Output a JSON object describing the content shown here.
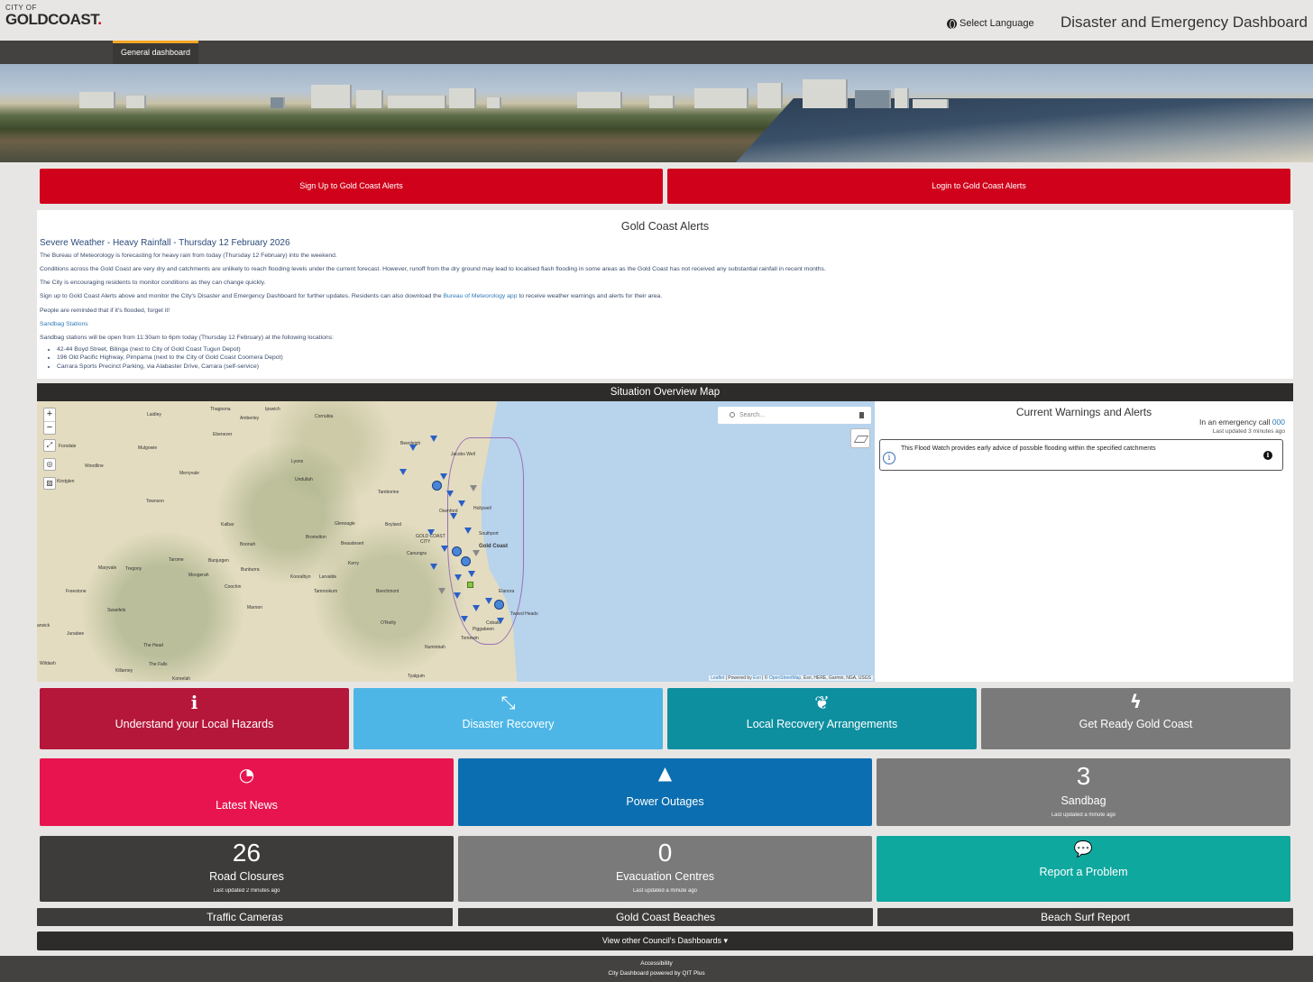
{
  "header": {
    "logo_small": "CITY OF",
    "logo_big": "GOLDCOAST",
    "logo_dot": ".",
    "language_label": "Select Language",
    "title": "Disaster and Emergency Dashboard"
  },
  "nav": {
    "tab": "General dashboard"
  },
  "alert_buttons": {
    "signup": "Sign Up to Gold Coast Alerts",
    "login": "Login to Gold Coast Alerts"
  },
  "alerts": {
    "heading": "Gold Coast Alerts",
    "subheading": "Severe Weather - Heavy Rainfall - Thursday 12 February 2026",
    "p1": "The Bureau of Meteorology is forecasting for heavy rain from today (Thursday 12 February) into the weekend.",
    "p2": "Conditions across the Gold Coast are very dry and catchments are unlikely to reach flooding levels under the current forecast. However, runoff from the dry ground may lead to localised flash flooding in some areas as the Gold Coast has not received any substantial rainfall in recent months.",
    "p3": "The City is encouraging residents to monitor conditions as they can change quickly.",
    "p4_pre": "Sign up to Gold Coast Alerts above and monitor the City's Disaster and Emergency Dashboard for further updates. Residents can also download the ",
    "p4_link": "Bureau of Meteorology app",
    "p4_post": " to receive weather warnings and alerts for their area.",
    "p5": "People are reminded that if it's flooded, forget it!",
    "sandbag_heading": "Sandbag Stations",
    "sandbag_intro": "Sandbag stations will be open from 11:30am to 6pm today (Thursday 12 February) at the following locations:",
    "locations": [
      "42-44 Boyd Street, Bilinga (next to City of Gold Coast Tugun Depot)",
      "196 Old Pacific Highway, Pimpama (next to the City of Gold Coast Coomera Depot)",
      "Carrara Sports Precinct Parking, via Alabaster Drive, Carrara (self-service)"
    ]
  },
  "map": {
    "title": "Situation Overview Map",
    "search_placeholder": "Search...",
    "zoom_in": "+",
    "zoom_out": "−",
    "attribution_leaflet": "Leaflet",
    "attribution_mid": " | Powered by ",
    "attribution_esri": "Esri",
    "attribution_sep": " | © ",
    "attribution_osm": "OpenStreetMap",
    "attribution_rest": ", Esri, HERE, Garmin, NGA, USGS",
    "labels": {
      "laidley": "Laidley",
      "thagoona": "Thagoona",
      "amberley": "Amberley",
      "ipswich": "Ipswich",
      "cornubia": "Cornubia",
      "ebenezer": "Ebenezer",
      "lyons": "Lyons",
      "forsdale": "Forsdale",
      "mulgowie": "Mulgowie",
      "woodline": "Woodline",
      "merryvale": "Merryvale",
      "undullah": "Undullah",
      "kirstglen": "Kirstglen",
      "townson": "Townson",
      "kalbar": "Kalbar",
      "glenoagle": "Glenoagle",
      "boonah": "Boonah",
      "bromelton": "Bromelton",
      "beaudesert": "Beaudesert",
      "boyland": "Boyland",
      "tamborine": "Tamborine",
      "oxenford": "Oxenford",
      "hollywell": "Hollywell",
      "southport": "Southport",
      "gold_coast": "Gold Coast",
      "city_label": "CITY",
      "gold_coast_city": "GOLD COAST",
      "kerry": "Kerry",
      "canungra": "Canungra",
      "maryvale": "Maryvale",
      "tregony": "Tregony",
      "tarome": "Tarome",
      "bunjurgen": "Bunjurgen",
      "bunburra": "Bunburra",
      "moogerah": "Moogerah",
      "kooralbyn": "Kooralbyn",
      "larvalde": "Larvalde",
      "freestone": "Freestone",
      "coochin": "Coochin",
      "tamrookum": "Tamrookum",
      "beechmont": "Beechmont",
      "elanora": "Elanora",
      "swanfels": "Swanfels",
      "maroon": "Maroon",
      "oreilly": "O'Reilly",
      "tweed_heads": "Tweed Heads",
      "cobaki": "Cobaki",
      "warwick": "arwick",
      "junabee": "Junabee",
      "piggabeen": "Piggabeen",
      "tomewin": "Tomewin",
      "numinbah": "Numinbah",
      "the_head": "The Head",
      "killarney": "Killarney",
      "the_falls": "The Falls",
      "wildash": "Wildash",
      "koreelah": "Koreelah",
      "tyalgum": "Tyalgum",
      "beenleigh": "Beenleigh",
      "jacobs_well": "Jacobs Well"
    }
  },
  "warnings": {
    "title": "Current Warnings and Alerts",
    "emergency_prefix": "In an emergency call ",
    "emergency_number": "000",
    "updated": "Last updated 3 minutes ago",
    "card_text": "This Flood Watch provides early advice of possible flooding within the specified catchments",
    "card_icon": "i"
  },
  "tiles_row1": [
    {
      "label": "Understand your Local Hazards",
      "icon": "info-icon",
      "glyph": "i",
      "color": "#b5173a"
    },
    {
      "label": "Disaster Recovery",
      "icon": "handshake-icon",
      "glyph": "⤡",
      "color": "#4db6e6"
    },
    {
      "label": "Local Recovery Arrangements",
      "icon": "leaf-icon",
      "glyph": "❦",
      "color": "#0e8fa0"
    },
    {
      "label": "Get Ready Gold Coast",
      "icon": "lightning-icon",
      "glyph": "ϟ",
      "color": "#7a7a7a"
    }
  ],
  "tiles_row2": [
    {
      "label": "Latest News",
      "icon": "rss-icon",
      "glyph": "◔",
      "color": "#e8144f"
    },
    {
      "label": "Power Outages",
      "icon": "power-warning-icon",
      "glyph": "▲",
      "color": "#0a6eb0"
    },
    {
      "label": "Sandbag",
      "number": "3",
      "sub": "Last updated a minute ago",
      "color": "#7a7a7a"
    }
  ],
  "tiles_row3": [
    {
      "label": "Road Closures",
      "number": "26",
      "sub": "Last updated 2 minutes ago",
      "color": "#3d3c3b"
    },
    {
      "label": "Evacuation Centres",
      "number": "0",
      "sub": "Last updated a minute ago",
      "color": "#7a7a7a"
    },
    {
      "label": "Report a Problem",
      "icon": "chat-icon",
      "glyph": "💬",
      "color": "#0fa89e"
    }
  ],
  "link_bars": [
    "Traffic Cameras",
    "Gold Coast Beaches",
    "Beach Surf Report"
  ],
  "other_dashboards": "View other Council's Dashboards ▾",
  "footer": {
    "accessibility": "Accessibility",
    "powered": "City Dashboard powered by QIT Plus"
  }
}
